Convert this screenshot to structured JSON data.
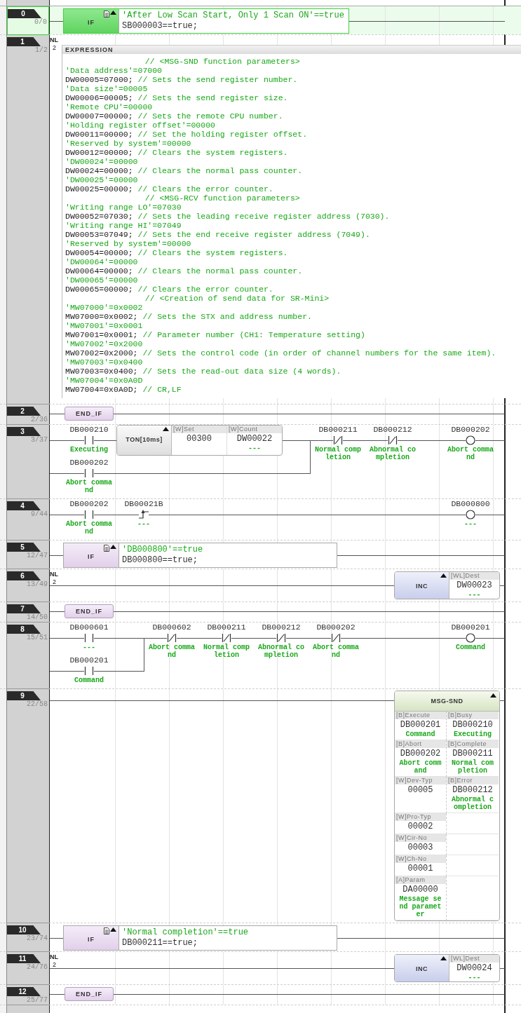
{
  "rungs": [
    {
      "kind": "if",
      "number": "0",
      "steps": "0/0",
      "selected": true,
      "keyword": "IF",
      "comment": "'After Low Scan Start, Only 1 Scan ON'==true",
      "expression": "SB000003==true;"
    },
    {
      "kind": "expression",
      "number": "1",
      "steps": "1/2",
      "selected": false,
      "nl": {
        "label": "NL",
        "value": "2"
      },
      "title": "EXPRESSION",
      "lines": [
        {
          "kind": "section",
          "comment": "// <MSG-SND function parameters>"
        },
        {
          "kind": "label",
          "comment": "'Data address'=07000"
        },
        {
          "kind": "code",
          "code": "DW00005=07000;",
          "comment": "// Sets the send register number."
        },
        {
          "kind": "label",
          "comment": "'Data size'=00005"
        },
        {
          "kind": "code",
          "code": "DW00006=00005;",
          "comment": "// Sets the send register size."
        },
        {
          "kind": "label",
          "comment": "'Remote CPU'=00000"
        },
        {
          "kind": "code",
          "code": "DW00007=00000;",
          "comment": "// Sets the remote CPU number."
        },
        {
          "kind": "label",
          "comment": "'Holding register offset'=00000"
        },
        {
          "kind": "code",
          "code": "DW00011=00000;",
          "comment": "// Set the holding register offset."
        },
        {
          "kind": "label",
          "comment": "'Reserved by system'=00000"
        },
        {
          "kind": "code",
          "code": "DW00012=00000;",
          "comment": "// Clears the system registers."
        },
        {
          "kind": "label",
          "comment": "'DW00024'=00000"
        },
        {
          "kind": "code",
          "code": "DW00024=00000;",
          "comment": "// Clears the normal pass counter."
        },
        {
          "kind": "label",
          "comment": "'DW00025'=00000"
        },
        {
          "kind": "code",
          "code": "DW00025=00000;",
          "comment": "// Clears the error counter."
        },
        {
          "kind": "section",
          "comment": "// <MSG-RCV function parameters>"
        },
        {
          "kind": "label",
          "comment": "'Writing range LO'=07030"
        },
        {
          "kind": "code",
          "code": "DW00052=07030;",
          "comment": "// Sets the leading receive register address (7030)."
        },
        {
          "kind": "label",
          "comment": "'Writing range HI'=07049"
        },
        {
          "kind": "code",
          "code": "DW00053=07049;",
          "comment": "// Sets the end receive register address (7049)."
        },
        {
          "kind": "label",
          "comment": "'Reserved by system'=00000"
        },
        {
          "kind": "code",
          "code": "DW00054=00000;",
          "comment": "// Clears the system registers."
        },
        {
          "kind": "label",
          "comment": "'DW00064'=00000"
        },
        {
          "kind": "code",
          "code": "DW00064=00000;",
          "comment": "// Clears the normal pass counter."
        },
        {
          "kind": "label",
          "comment": "'DW00065'=00000"
        },
        {
          "kind": "code",
          "code": "DW00065=00000;",
          "comment": "// Clears the error counter."
        },
        {
          "kind": "section",
          "comment": "// <Creation of send data for SR-Mini>"
        },
        {
          "kind": "label",
          "comment": "'MW07000'=0x0002"
        },
        {
          "kind": "code",
          "code": "MW07000=0x0002;",
          "comment": "// Sets the STX and address number."
        },
        {
          "kind": "label",
          "comment": "'MW07001'=0x0001"
        },
        {
          "kind": "code",
          "code": "MW07001=0x0001;",
          "comment": "// Parameter number (CH1: Temperature setting)"
        },
        {
          "kind": "label",
          "comment": "'MW07002'=0x2000"
        },
        {
          "kind": "code",
          "code": "MW07002=0x2000;",
          "comment": "// Sets the control code (in order of channel numbers for the same item)."
        },
        {
          "kind": "label",
          "comment": "'MW07003'=0x0400"
        },
        {
          "kind": "code",
          "code": "MW07003=0x0400;",
          "comment": "// Sets the read-out data size (4 words)."
        },
        {
          "kind": "label",
          "comment": "'MW07004'=0x0A0D"
        },
        {
          "kind": "code",
          "code": "MW07004=0x0A0D;",
          "comment": "// CR,LF"
        }
      ]
    },
    {
      "kind": "end_if",
      "number": "2",
      "steps": "2/36",
      "selected": false,
      "keyword": "END_IF"
    },
    {
      "kind": "ladder",
      "number": "3",
      "steps": "3/37",
      "selected": false,
      "branch": [
        [
          {
            "kind": "contact_no",
            "address": "DB000210",
            "comment": "Executing"
          },
          {
            "kind": "timer",
            "name": "TON[10ms]",
            "params": [
              {
                "label": "[W]Set",
                "value": "00300"
              },
              {
                "label": "[W]Count",
                "value": "DW00022",
                "comment": "---"
              }
            ]
          }
        ],
        [
          {
            "kind": "contact_no",
            "address": "DB000202",
            "comment": "Abort command"
          }
        ]
      ],
      "series": [
        {
          "kind": "contact_nc",
          "address": "DB000211",
          "comment": "Normal completion"
        },
        {
          "kind": "contact_nc",
          "address": "DB000212",
          "comment": "Abnormal completion"
        }
      ],
      "output": {
        "kind": "coil",
        "address": "DB000202",
        "comment": "Abort command"
      }
    },
    {
      "kind": "ladder",
      "number": "4",
      "steps": "9/44",
      "selected": false,
      "series": [
        {
          "kind": "contact_no",
          "address": "DB000202",
          "comment": "Abort command"
        },
        {
          "kind": "rising_edge",
          "address": "DB00021B",
          "comment": "---"
        }
      ],
      "output": {
        "kind": "coil",
        "address": "DB000800",
        "comment": "---"
      }
    },
    {
      "kind": "if",
      "number": "5",
      "steps": "12/47",
      "selected": false,
      "keyword": "IF",
      "comment": "'DB000800'==true",
      "expression": "DB000800==true;"
    },
    {
      "kind": "inc",
      "number": "6",
      "steps": "13/49",
      "selected": false,
      "nl": {
        "label": "NL",
        "value": "2"
      },
      "block": {
        "kind": "inc",
        "name": "INC",
        "params": [
          {
            "label": "[WL]Dest",
            "value": "DW00023",
            "comment": "---"
          }
        ]
      }
    },
    {
      "kind": "end_if",
      "number": "7",
      "steps": "14/50",
      "selected": false,
      "keyword": "END_IF"
    },
    {
      "kind": "ladder",
      "number": "8",
      "steps": "15/51",
      "selected": false,
      "branch": [
        [
          {
            "kind": "contact_no",
            "address": "DB000601",
            "comment": "---"
          }
        ],
        [
          {
            "kind": "contact_no",
            "address": "DB000201",
            "comment": "Command"
          }
        ]
      ],
      "series": [
        {
          "kind": "contact_nc",
          "address": "DB000602",
          "comment": "Abort command"
        },
        {
          "kind": "contact_nc",
          "address": "DB000211",
          "comment": "Normal completion"
        },
        {
          "kind": "contact_nc",
          "address": "DB000212",
          "comment": "Abnormal completion"
        },
        {
          "kind": "contact_nc",
          "address": "DB000202",
          "comment": "Abort command"
        }
      ],
      "output": {
        "kind": "coil",
        "address": "DB000201",
        "comment": "Command"
      }
    },
    {
      "kind": "function",
      "number": "9",
      "steps": "22/58",
      "selected": false,
      "block": {
        "name": "MSG-SND",
        "inputs": [
          {
            "label": "[B]Execute",
            "value": "DB000201",
            "comment": "Command"
          },
          {
            "label": "[B]Abort",
            "value": "DB000202",
            "comment": "Abort command"
          },
          {
            "label": "[W]Dev-Typ",
            "value": "00005"
          },
          {
            "label": "[W]Pro-Typ",
            "value": "00002"
          },
          {
            "label": "[W]Cir-No",
            "value": "00003"
          },
          {
            "label": "[W]Ch-No",
            "value": "00001"
          },
          {
            "label": "[A]Param",
            "value": "DA00000",
            "comment": "Message send parameter"
          }
        ],
        "outputs": [
          {
            "label": "[B]Busy",
            "value": "DB000210",
            "comment": "Executing"
          },
          {
            "label": "[B]Complete",
            "value": "DB000211",
            "comment": "Normal completion"
          },
          {
            "label": "[B]Error",
            "value": "DB000212",
            "comment": "Abnormal completion"
          }
        ]
      }
    },
    {
      "kind": "if",
      "number": "10",
      "steps": "23/74",
      "selected": false,
      "keyword": "IF",
      "comment": "'Normal completion'==true",
      "expression": "DB000211==true;"
    },
    {
      "kind": "inc",
      "number": "11",
      "steps": "24/76",
      "selected": false,
      "nl": {
        "label": "NL",
        "value": "2"
      },
      "block": {
        "kind": "inc",
        "name": "INC",
        "params": [
          {
            "label": "[WL]Dest",
            "value": "DW00024",
            "comment": "---"
          }
        ]
      }
    },
    {
      "kind": "end_if",
      "number": "12",
      "steps": "25/77",
      "selected": false,
      "keyword": "END_IF"
    }
  ]
}
